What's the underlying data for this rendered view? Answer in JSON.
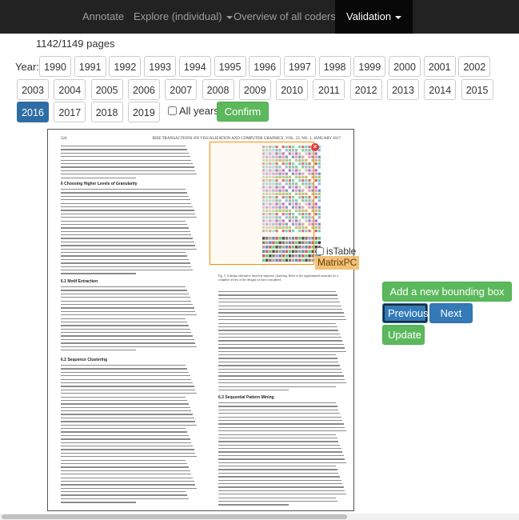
{
  "nav": {
    "items": [
      {
        "label": "Annotate",
        "dropdown": false
      },
      {
        "label": "Explore (individual)",
        "dropdown": true
      },
      {
        "label": "Overview of all coders",
        "dropdown": true
      },
      {
        "label": "Validation",
        "dropdown": true,
        "active": true
      }
    ]
  },
  "progress": {
    "pages_text": "1142/1149 pages"
  },
  "year_filter": {
    "label": "Year:",
    "years": [
      "1990",
      "1991",
      "1992",
      "1993",
      "1994",
      "1995",
      "1996",
      "1997",
      "1998",
      "1999",
      "2000",
      "2001",
      "2002",
      "2003",
      "2004",
      "2005",
      "2006",
      "2007",
      "2008",
      "2009",
      "2010",
      "2011",
      "2012",
      "2013",
      "2014",
      "2015",
      "2016",
      "2017",
      "2018",
      "2019"
    ],
    "selected": "2016",
    "all_years_label": "All years",
    "all_years_checked": false,
    "confirm_label": "Confirm"
  },
  "document": {
    "page_number": "324",
    "journal_header": "IEEE TRANSACTIONS ON VISUALIZATION AND COMPUTER GRAPHICS,   VOL. 23,  NO. 1,   JANUARY 2017",
    "section_6_title": "6  Choosing Higher Levels of Granularity",
    "section_6_1_title": "6.1  Motif Extraction",
    "section_6_2_title": "6.2  Sequence Clustering",
    "section_6_3_title": "6.3  Sequential Pattern Mining",
    "figure_caption": "Fig. 5. A design alternative based on sequence clustering. Refer to the supplemental materials for a complete review of the designs we have considered."
  },
  "annotation": {
    "istable_label": "isTable",
    "istable_checked": false,
    "class_label": "MatrixPC",
    "close_glyph": "×"
  },
  "controls": {
    "add_box_label": "Add a new bounding box",
    "previous_label": "Previous",
    "next_label": "Next",
    "update_label": "Update"
  },
  "colors": {
    "navbar": "#222222",
    "selected_year": "#337ab7",
    "green_button": "#5cb85c",
    "annotation_box": "#ff8c00",
    "label_bg": "#f0c27a"
  }
}
